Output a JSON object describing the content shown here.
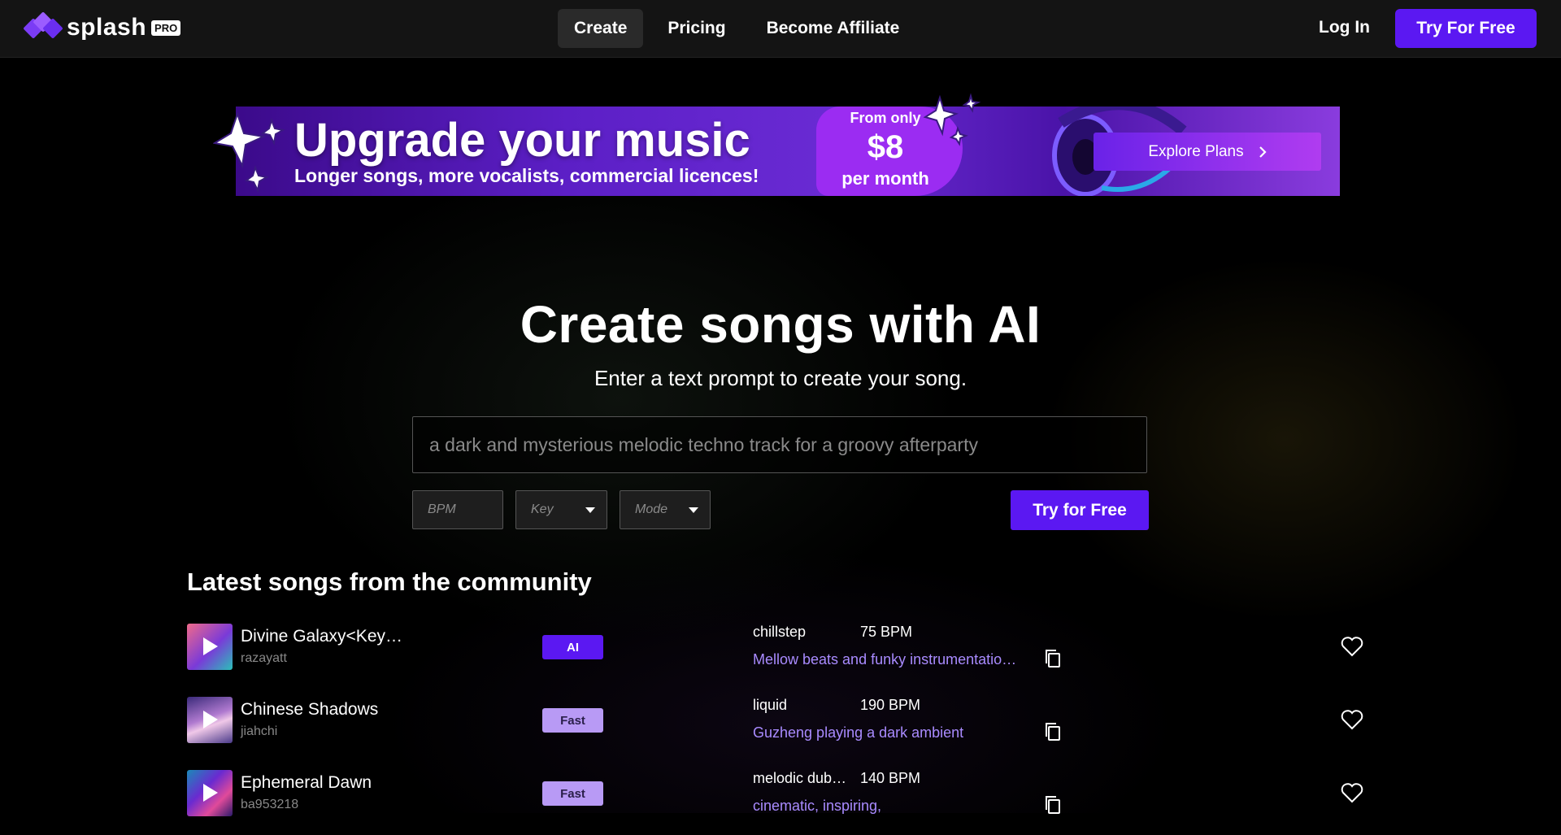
{
  "nav": {
    "brand": "splash",
    "badge": "PRO",
    "links": [
      {
        "label": "Create",
        "active": true
      },
      {
        "label": "Pricing",
        "active": false
      },
      {
        "label": "Become Affiliate",
        "active": false
      }
    ],
    "login": "Log In",
    "cta": "Try For Free"
  },
  "banner": {
    "title": "Upgrade your music",
    "subtitle": "Longer songs, more vocalists, commercial licences!",
    "price_from": "From only",
    "price_amount": "$8",
    "price_period": "per month",
    "button": "Explore Plans"
  },
  "hero": {
    "title": "Create songs with AI",
    "subtitle": "Enter a text prompt to create your song.",
    "prompt_placeholder": "a dark and mysterious melodic techno track for a groovy afterparty",
    "bpm_placeholder": "BPM",
    "key_placeholder": "Key",
    "mode_placeholder": "Mode",
    "submit": "Try for Free"
  },
  "community": {
    "title": "Latest songs from the community",
    "songs": [
      {
        "title": "Divine Galaxy<Key…",
        "user": "razayatt",
        "tag": "AI",
        "genre": "chillstep",
        "bpm": "75 BPM",
        "description": "Mellow beats and funky instrumentatio…"
      },
      {
        "title": "Chinese Shadows",
        "user": "jiahchi",
        "tag": "Fast",
        "genre": "liquid",
        "bpm": "190 BPM",
        "description": "Guzheng playing a dark ambient"
      },
      {
        "title": "Ephemeral Dawn",
        "user": "ba953218",
        "tag": "Fast",
        "genre": "melodic dub…",
        "bpm": "140 BPM",
        "description": "cinematic, inspiring,"
      }
    ]
  },
  "colors": {
    "accent": "#5b18f2",
    "link_purple": "#a98bff",
    "tag_fast": "#b89af5",
    "nav_bg": "#141414"
  },
  "icons": [
    "splash-logo-icon",
    "play-icon",
    "copy-icon",
    "heart-icon",
    "chevron-right-icon",
    "caret-down-icon",
    "sparkle-star-icon",
    "headphones-icon"
  ]
}
